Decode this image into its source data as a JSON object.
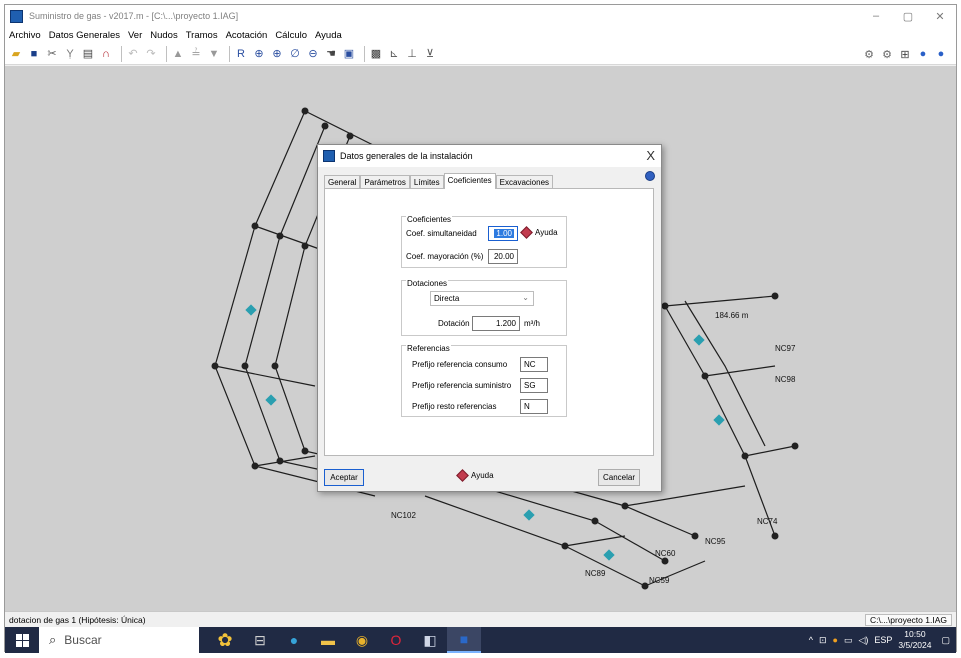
{
  "window": {
    "title": "Suministro de gas - v2017.m - [C:\\...\\proyecto 1.IAG]",
    "controls": [
      "–",
      "▢",
      "✕"
    ]
  },
  "menu": [
    "Archivo",
    "Datos Generales",
    "Ver",
    "Nudos",
    "Tramos",
    "Acotación",
    "Cálculo",
    "Ayuda"
  ],
  "plan_labels": {
    "dim1": "184.66 m",
    "nodes": [
      "NC102",
      "NC60",
      "NC59",
      "NC95",
      "NC74",
      "NC97",
      "NC98",
      "NC89"
    ]
  },
  "dialog": {
    "title": "Datos generales de la instalación",
    "close": "X",
    "tabs": [
      "General",
      "Parámetros",
      "Límites",
      "Coeficientes",
      "Excavaciones"
    ],
    "active_tab": "Coeficientes",
    "coeficientes": {
      "group": "Coeficientes",
      "simult_label": "Coef. simultaneidad",
      "simult_value": "1.00",
      "help": "Ayuda",
      "mayor_label": "Coef. mayoración (%)",
      "mayor_value": "20.00"
    },
    "dotaciones": {
      "group": "Dotaciones",
      "mode": "Directa",
      "dot_label": "Dotación",
      "dot_value": "1.200",
      "dot_unit": "m³/h"
    },
    "referencias": {
      "group": "Referencias",
      "consumo_label": "Prefijo referencia consumo",
      "consumo_value": "NC",
      "suministro_label": "Prefijo referencia suministro",
      "suministro_value": "SG",
      "resto_label": "Prefijo resto referencias",
      "resto_value": "N"
    },
    "buttons": {
      "accept": "Aceptar",
      "help": "Ayuda",
      "cancel": "Cancelar"
    }
  },
  "status": {
    "left": "dotacion de gas 1 (Hipótesis: Única)",
    "right": "C:\\...\\proyecto 1.IAG"
  },
  "taskbar": {
    "search": "Buscar",
    "lang": "ESP",
    "time": "10:50",
    "date": "3/5/2024"
  }
}
